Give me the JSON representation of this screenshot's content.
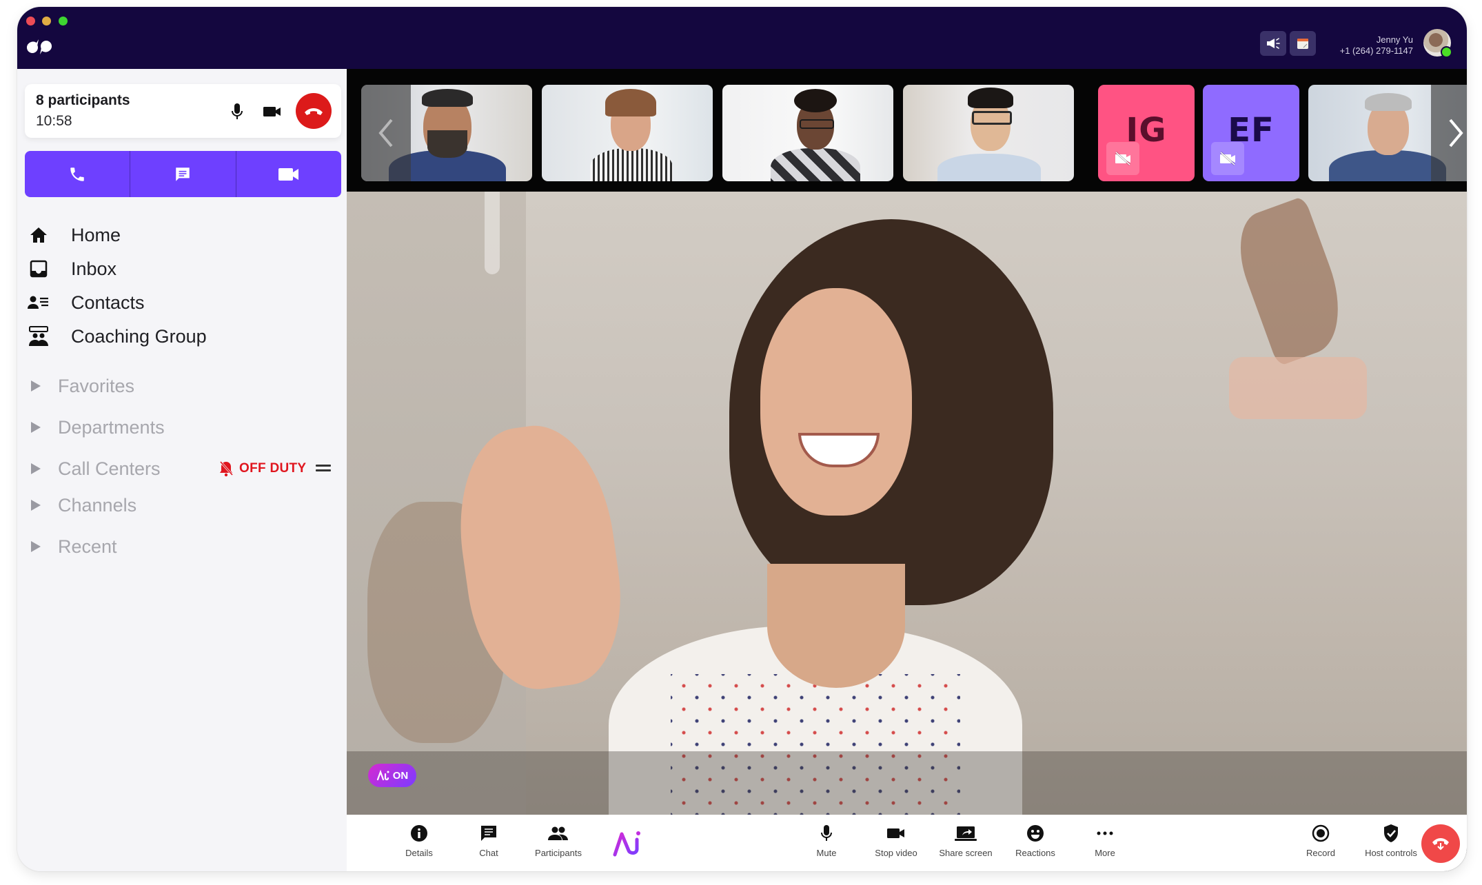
{
  "window": {
    "logo": "dialpad-logo",
    "header": {
      "announcements_icon": "megaphone-icon",
      "calendar_icon": "calendar-icon",
      "user_name": "Jenny Yu",
      "user_phone": "+1 (264) 279-1147",
      "presence_color": "#4ade25"
    }
  },
  "sidebar": {
    "call_card": {
      "participants_label": "8 participants",
      "duration": "10:58"
    },
    "actions": [
      "call-icon",
      "message-icon",
      "video-icon"
    ],
    "nav": [
      {
        "label": "Home",
        "icon": "home-icon"
      },
      {
        "label": "Inbox",
        "icon": "inbox-icon"
      },
      {
        "label": "Contacts",
        "icon": "contacts-icon"
      },
      {
        "label": "Coaching Group",
        "icon": "coaching-group-icon"
      }
    ],
    "sections": [
      {
        "label": "Favorites"
      },
      {
        "label": "Departments"
      },
      {
        "label": "Call Centers",
        "status": "OFF DUTY"
      },
      {
        "label": "Channels"
      },
      {
        "label": "Recent"
      }
    ]
  },
  "participants_strip": {
    "tiles": [
      {
        "type": "video",
        "name": "participant-1"
      },
      {
        "type": "video",
        "name": "participant-2"
      },
      {
        "type": "video",
        "name": "participant-3"
      },
      {
        "type": "video",
        "name": "participant-4"
      },
      {
        "type": "initials",
        "initials": "IG",
        "bg": "#ff5383",
        "fg": "#5a0f2c",
        "camera": "off"
      },
      {
        "type": "initials",
        "initials": "EF",
        "bg": "#8f6bff",
        "fg": "#1a0b4a",
        "camera": "off"
      },
      {
        "type": "video",
        "name": "participant-7"
      }
    ]
  },
  "main_video": {
    "ai_badge": "ON"
  },
  "toolbar": {
    "left": [
      {
        "label": "Details",
        "icon": "info-icon"
      },
      {
        "label": "Chat",
        "icon": "chat-icon"
      },
      {
        "label": "Participants",
        "icon": "participants-icon"
      }
    ],
    "ai_logo": "ai-assistant-icon",
    "center": [
      {
        "label": "Mute",
        "icon": "microphone-icon"
      },
      {
        "label": "Stop video",
        "icon": "video-camera-icon"
      },
      {
        "label": "Share screen",
        "icon": "share-screen-icon"
      },
      {
        "label": "Reactions",
        "icon": "smiley-icon"
      },
      {
        "label": "More",
        "icon": "more-icon"
      }
    ],
    "right": [
      {
        "label": "Record",
        "icon": "record-icon"
      },
      {
        "label": "Host controls",
        "icon": "shield-check-icon"
      }
    ]
  },
  "colors": {
    "titlebar": "#14073f",
    "accent": "#6e40ff",
    "danger": "#dc1a1a",
    "hangup": "#f04848"
  }
}
